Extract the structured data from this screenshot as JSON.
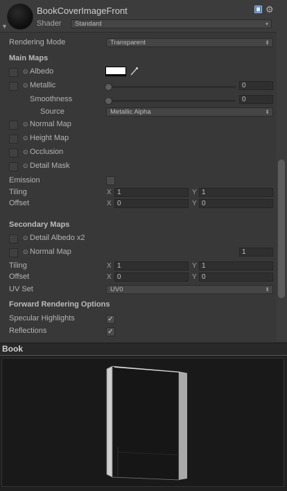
{
  "header": {
    "material_name": "BookCoverImageFront",
    "shader_label": "Shader",
    "shader_value": "Standard"
  },
  "rendering_mode": {
    "label": "Rendering Mode",
    "value": "Transparent"
  },
  "main_maps": {
    "title": "Main Maps",
    "albedo_label": "Albedo",
    "albedo_color": "#ffffff",
    "metallic_label": "Metallic",
    "metallic_value": "0",
    "smoothness_label": "Smoothness",
    "smoothness_value": "0",
    "source_label": "Source",
    "source_value": "Metallic Alpha",
    "normal_map_label": "Normal Map",
    "height_map_label": "Height Map",
    "occlusion_label": "Occlusion",
    "detail_mask_label": "Detail Mask",
    "emission_label": "Emission",
    "tiling_label": "Tiling",
    "tiling_x": "1",
    "tiling_y": "1",
    "offset_label": "Offset",
    "offset_x": "0",
    "offset_y": "0"
  },
  "secondary_maps": {
    "title": "Secondary Maps",
    "detail_albedo_label": "Detail Albedo x2",
    "normal_map_label": "Normal Map",
    "normal_map_value": "1",
    "tiling_label": "Tiling",
    "tiling_x": "1",
    "tiling_y": "1",
    "offset_label": "Offset",
    "offset_x": "0",
    "offset_y": "0",
    "uv_set_label": "UV Set",
    "uv_set_value": "UV0"
  },
  "forward_rendering": {
    "title": "Forward Rendering Options",
    "specular_label": "Specular Highlights",
    "specular_checked": true,
    "reflections_label": "Reflections",
    "reflections_checked": true
  },
  "axis_labels": {
    "x": "X",
    "y": "Y"
  },
  "glyphs": {
    "check": "✓",
    "circle": "⊙",
    "arrow_down": "▾",
    "updown": "⬍",
    "foldout": "▼",
    "gear": "⚙"
  },
  "preview": {
    "title": "Book"
  },
  "colors": {
    "panel": "#383838",
    "header": "#3c3c3c",
    "preview_bg": "#191919",
    "book_cover": "#161616",
    "book_edge": "#b9b9b9"
  }
}
